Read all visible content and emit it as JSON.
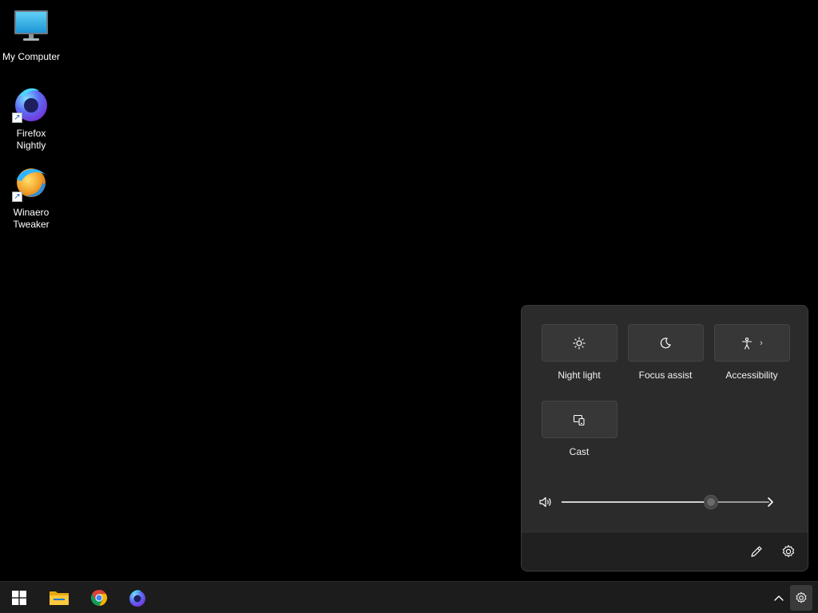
{
  "desktop": {
    "icons": [
      {
        "label": "My Computer",
        "icon": "computer-icon"
      },
      {
        "label": "Firefox\nNightly",
        "icon": "firefox-nightly-icon"
      },
      {
        "label": "Winaero\nTweaker",
        "icon": "winaero-tweaker-icon"
      }
    ]
  },
  "quick_settings": {
    "tiles": [
      {
        "label": "Night light",
        "icon": "brightness-icon"
      },
      {
        "label": "Focus assist",
        "icon": "moon-icon"
      },
      {
        "label": "Accessibility",
        "icon": "accessibility-icon",
        "chevron": "›"
      },
      {
        "label": "Cast",
        "icon": "cast-icon"
      }
    ],
    "volume": {
      "level": 0.72,
      "icon": "speaker-icon"
    },
    "footer": {
      "edit_icon": "pencil-icon",
      "settings_icon": "gear-icon"
    }
  },
  "taskbar": {
    "pinned": [
      {
        "name": "start-button",
        "icon": "windows-logo-icon"
      },
      {
        "name": "file-explorer",
        "icon": "folder-icon"
      },
      {
        "name": "chrome",
        "icon": "chrome-icon"
      },
      {
        "name": "firefox-nightly",
        "icon": "firefox-nightly-icon"
      }
    ],
    "tray": {
      "overflow_icon": "chevron-up-icon",
      "settings_icon": "gear-icon"
    }
  },
  "colors": {
    "flyout_bg": "#2b2b2b",
    "tile_bg": "#373737",
    "taskbar_bg": "#1c1c1c",
    "desktop_bg": "#000000"
  }
}
